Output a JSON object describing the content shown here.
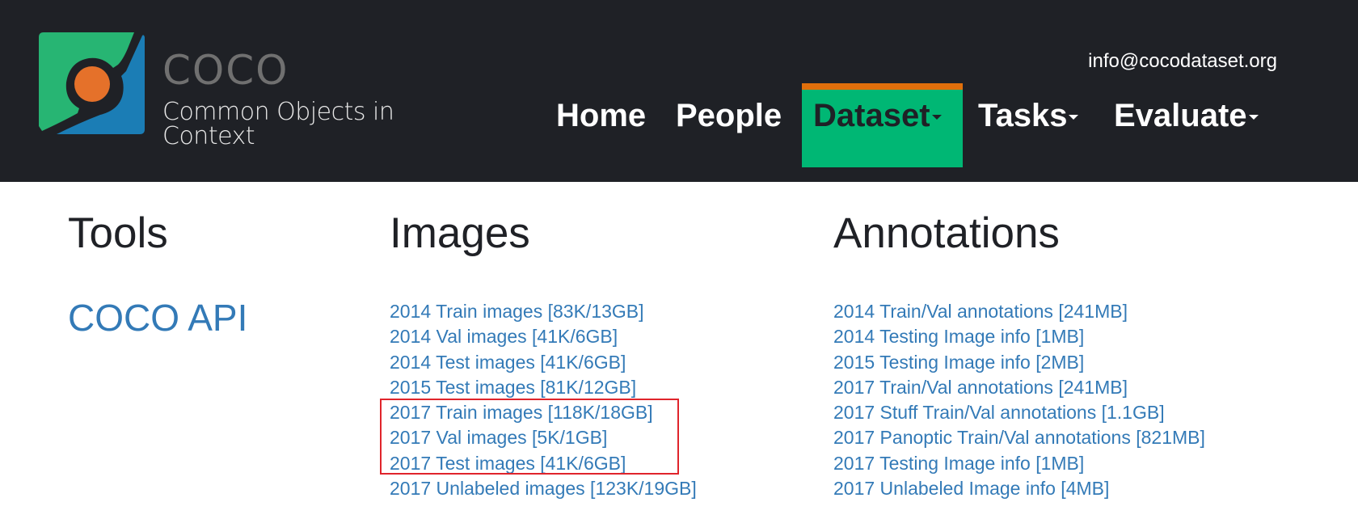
{
  "header": {
    "logo": {
      "title": "COCO",
      "subtitle": "Common Objects in Context",
      "colors": {
        "green": "#27b573",
        "blue": "#1b7db5",
        "orange": "#e5712a",
        "dark": "#1f2126"
      }
    },
    "email": "info@cocodataset.org",
    "nav": [
      {
        "label": "Home",
        "dropdown": false,
        "active": false
      },
      {
        "label": "People",
        "dropdown": false,
        "active": false
      },
      {
        "label": "Dataset",
        "dropdown": true,
        "active": true
      },
      {
        "label": "Tasks",
        "dropdown": true,
        "active": false
      },
      {
        "label": "Evaluate",
        "dropdown": true,
        "active": false
      }
    ],
    "active_colors": {
      "background": "#00b774",
      "top_bar": "#e06f0b"
    }
  },
  "tools": {
    "heading": "Tools",
    "link": "COCO API"
  },
  "images": {
    "heading": "Images",
    "links": [
      "2014 Train images [83K/13GB]",
      "2014 Val images [41K/6GB]",
      "2014 Test images [41K/6GB]",
      "2015 Test images [81K/12GB]",
      "2017 Train images [118K/18GB]",
      "2017 Val images [5K/1GB]",
      "2017 Test images [41K/6GB]",
      "2017 Unlabeled images [123K/19GB]"
    ],
    "highlighted": [
      "2017 Train images [118K/18GB]",
      "2017 Val images [5K/1GB]",
      "2017 Test images [41K/6GB]"
    ]
  },
  "annotations": {
    "heading": "Annotations",
    "links": [
      "2014 Train/Val annotations [241MB]",
      "2014 Testing Image info [1MB]",
      "2015 Testing Image info [2MB]",
      "2017 Train/Val annotations [241MB]",
      "2017 Stuff Train/Val annotations [1.1GB]",
      "2017 Panoptic Train/Val annotations [821MB]",
      "2017 Testing Image info [1MB]",
      "2017 Unlabeled Image info [4MB]"
    ]
  },
  "link_color": "#337ab7",
  "highlight_color": "#e0242b"
}
